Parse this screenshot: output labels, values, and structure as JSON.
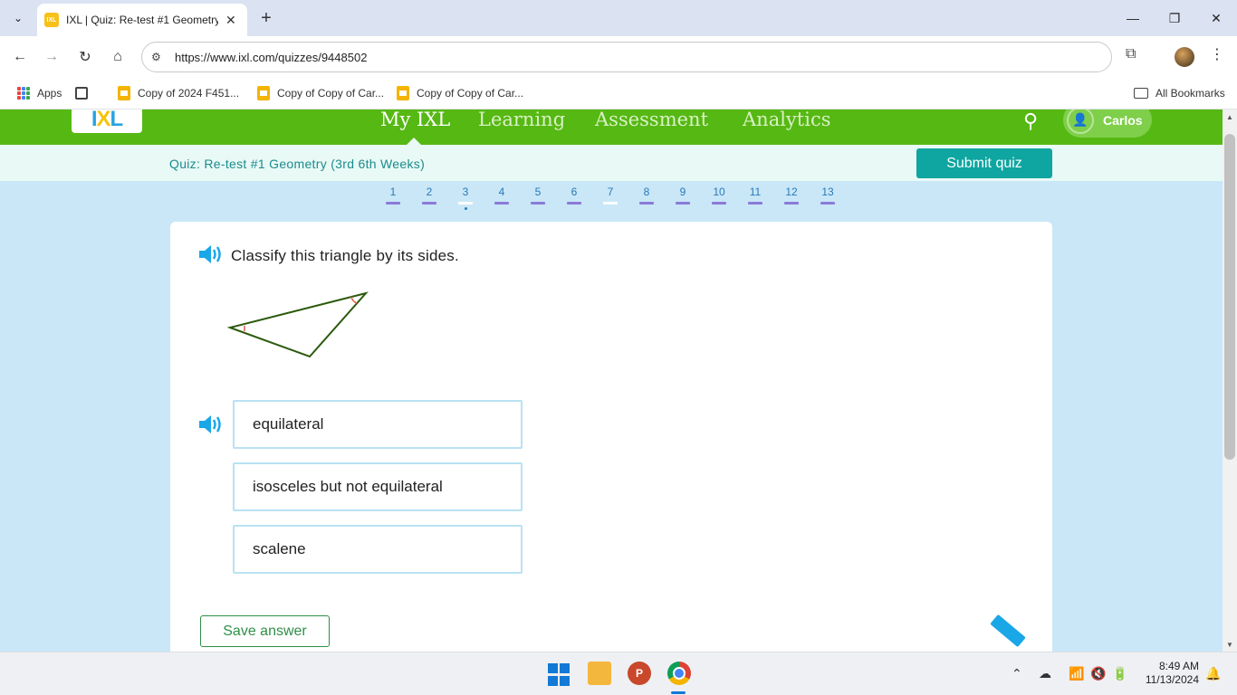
{
  "browser": {
    "tab_title": "IXL | Quiz: Re-test #1 Geometry",
    "favicon_text": "IXL",
    "url": "https://www.ixl.com/quizzes/9448502",
    "bookmarks": [
      {
        "label": "Apps"
      },
      {
        "label": "Copy of 2024 F451..."
      },
      {
        "label": "Copy of Copy of Car..."
      },
      {
        "label": "Copy of Copy of Car..."
      }
    ],
    "all_bookmarks": "All Bookmarks"
  },
  "ixl": {
    "logo": {
      "i": "I",
      "x": "X",
      "l": "L"
    },
    "nav": [
      "My IXL",
      "Learning",
      "Assessment",
      "Analytics"
    ],
    "active_nav": "My IXL",
    "user_name": "Carlos",
    "quiz_title": "Quiz: Re-test #1 Geometry (3rd 6th Weeks)",
    "submit_label": "Submit quiz",
    "questions": [
      "1",
      "2",
      "3",
      "4",
      "5",
      "6",
      "7",
      "8",
      "9",
      "10",
      "11",
      "12",
      "13"
    ],
    "current_question": "3",
    "question_text": "Classify this triangle by its sides.",
    "choices": [
      "equilateral",
      "isosceles but not equilateral",
      "scalene"
    ],
    "save_label": "Save answer"
  },
  "taskbar": {
    "time": "8:49 AM",
    "date": "11/13/2024"
  },
  "colors": {
    "ixl_green": "#56b813",
    "submit_teal": "#0fa5a0",
    "page_bg": "#c9e7f7",
    "triangle_stroke": "#2d5a0e",
    "angle_marks": "#e05a4a"
  }
}
